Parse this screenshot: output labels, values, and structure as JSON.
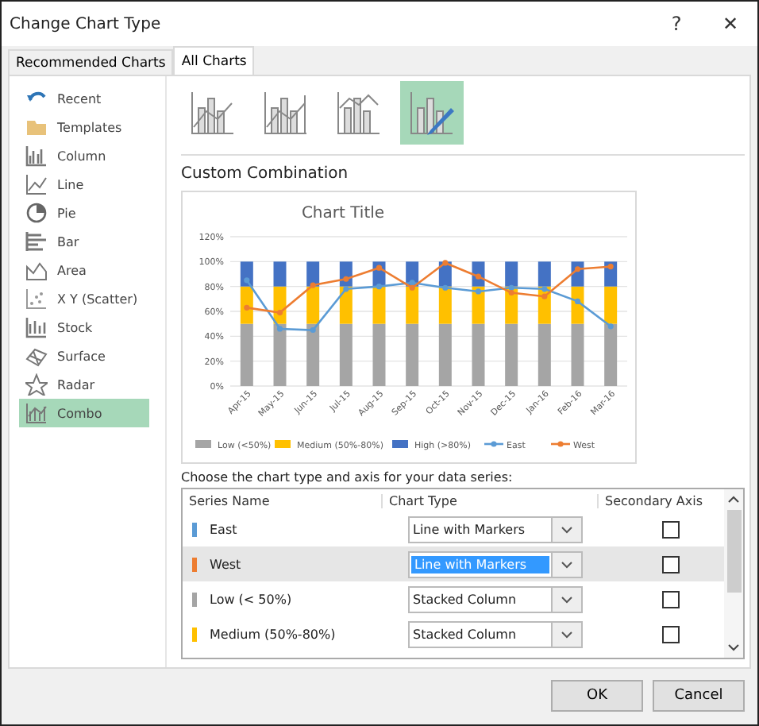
{
  "window": {
    "title": "Change Chart Type",
    "help": "?",
    "close": "✕"
  },
  "tabs": [
    {
      "label": "Recommended Charts",
      "selected": false
    },
    {
      "label": "All Charts",
      "selected": true
    }
  ],
  "sidebar": {
    "items": [
      {
        "label": "Recent",
        "selected": false
      },
      {
        "label": "Templates",
        "selected": false
      },
      {
        "label": "Column",
        "selected": false
      },
      {
        "label": "Line",
        "selected": false
      },
      {
        "label": "Pie",
        "selected": false
      },
      {
        "label": "Bar",
        "selected": false
      },
      {
        "label": "Area",
        "selected": false
      },
      {
        "label": "X Y (Scatter)",
        "selected": false
      },
      {
        "label": "Stock",
        "selected": false
      },
      {
        "label": "Surface",
        "selected": false
      },
      {
        "label": "Radar",
        "selected": false
      },
      {
        "label": "Combo",
        "selected": true
      }
    ]
  },
  "subtypes": [
    {
      "selected": false
    },
    {
      "selected": false
    },
    {
      "selected": false
    },
    {
      "selected": true
    }
  ],
  "section_title": "Custom Combination",
  "chart": {
    "chart_data": {
      "type": "bar",
      "title": "Chart Title",
      "stacked": true,
      "categories": [
        "Apr-15",
        "May-15",
        "Jun-15",
        "Jul-15",
        "Aug-15",
        "Sep-15",
        "Oct-15",
        "Nov-15",
        "Dec-15",
        "Jan-16",
        "Feb-16",
        "Mar-16"
      ],
      "yticks": [
        {
          "value": 0,
          "label": "0%"
        },
        {
          "value": 20,
          "label": "20%"
        },
        {
          "value": 40,
          "label": "40%"
        },
        {
          "value": 60,
          "label": "60%"
        },
        {
          "value": 80,
          "label": "80%"
        },
        {
          "value": 100,
          "label": "100%"
        },
        {
          "value": 120,
          "label": "120%"
        }
      ],
      "ylim": [
        0,
        120
      ],
      "grid": true,
      "legend": "bottom",
      "series": [
        {
          "name": "Low (<50%)",
          "color": "#a5a5a5",
          "type": "bar",
          "values": [
            50,
            50,
            50,
            50,
            50,
            50,
            50,
            50,
            50,
            50,
            50,
            50
          ]
        },
        {
          "name": "Medium (50%-80%)",
          "color": "#ffc000",
          "type": "bar",
          "values": [
            30,
            30,
            30,
            30,
            30,
            30,
            30,
            30,
            30,
            30,
            30,
            30
          ]
        },
        {
          "name": "High (>80%)",
          "color": "#4472c4",
          "type": "bar",
          "values": [
            20,
            20,
            20,
            20,
            20,
            20,
            20,
            20,
            20,
            20,
            20,
            20
          ]
        },
        {
          "name": "East",
          "color": "#5b9bd5",
          "type": "line",
          "marker": "circle",
          "values": [
            85,
            46,
            45,
            78,
            80,
            83,
            79,
            76,
            79,
            78,
            68,
            48
          ]
        },
        {
          "name": "West",
          "color": "#ed7d31",
          "type": "line",
          "marker": "circle",
          "values": [
            63,
            59,
            81,
            86,
            95,
            79,
            99,
            88,
            75,
            72,
            94,
            96
          ]
        }
      ]
    }
  },
  "series_prompt": "Choose the chart type and axis for your data series:",
  "series_table": {
    "columns": [
      "Series Name",
      "Chart Type",
      "Secondary Axis"
    ],
    "rows": [
      {
        "name": "East",
        "color": "#5b9bd5",
        "chart_type": "Line with Markers",
        "secondary_axis": false,
        "selected": false
      },
      {
        "name": "West",
        "color": "#ed7d31",
        "chart_type": "Line with Markers",
        "secondary_axis": false,
        "selected": true
      },
      {
        "name": "Low (< 50%)",
        "color": "#a5a5a5",
        "chart_type": "Stacked Column",
        "secondary_axis": false,
        "selected": false
      },
      {
        "name": "Medium (50%-80%)",
        "color": "#ffc000",
        "chart_type": "Stacked Column",
        "secondary_axis": false,
        "selected": false
      }
    ]
  },
  "buttons": [
    "OK",
    "Cancel"
  ]
}
